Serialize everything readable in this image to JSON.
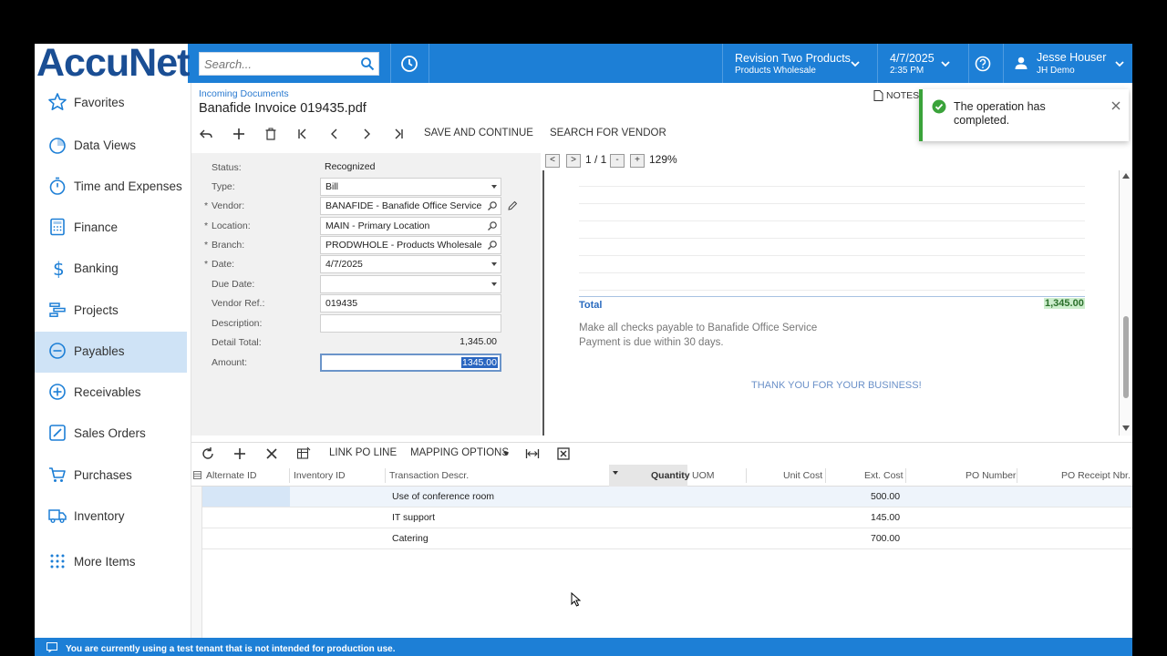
{
  "app": {
    "logo": "AccuNet"
  },
  "colors": {
    "brand": "#1d7fd6",
    "active_nav": "#cfe3f6",
    "success": "#3aa33a"
  },
  "search": {
    "placeholder": "Search..."
  },
  "header": {
    "company": "Revision Two Products",
    "branch": "Products Wholesale",
    "date": "4/7/2025",
    "time": "2:35 PM",
    "user": "Jesse Houser",
    "tenant": "JH Demo"
  },
  "sidebar": {
    "items": [
      {
        "label": "Favorites",
        "icon": "star-icon"
      },
      {
        "label": "Data Views",
        "icon": "pie-chart-icon"
      },
      {
        "label": "Time and Expenses",
        "icon": "stopwatch-icon"
      },
      {
        "label": "Finance",
        "icon": "calculator-icon"
      },
      {
        "label": "Banking",
        "icon": "dollar-icon"
      },
      {
        "label": "Projects",
        "icon": "gantt-icon"
      },
      {
        "label": "Payables",
        "icon": "minus-circle-icon",
        "active": true
      },
      {
        "label": "Receivables",
        "icon": "plus-circle-icon"
      },
      {
        "label": "Sales Orders",
        "icon": "edit-icon"
      },
      {
        "label": "Purchases",
        "icon": "cart-icon"
      },
      {
        "label": "Inventory",
        "icon": "truck-icon"
      },
      {
        "label": "More Items",
        "icon": "grid-dots-icon"
      }
    ]
  },
  "page": {
    "breadcrumb": "Incoming Documents",
    "title": "Banafide Invoice 019435.pdf",
    "notes": "NOTES"
  },
  "toolbar": {
    "save_continue": "SAVE AND CONTINUE",
    "search_vendor": "SEARCH FOR VENDOR"
  },
  "form": {
    "status": {
      "label": "Status:",
      "value": "Recognized"
    },
    "type": {
      "label": "Type:",
      "value": "Bill"
    },
    "vendor": {
      "label": "Vendor:",
      "value": "BANAFIDE - Banafide Office Service"
    },
    "location": {
      "label": "Location:",
      "value": "MAIN - Primary Location"
    },
    "branch": {
      "label": "Branch:",
      "value": "PRODWHOLE - Products Wholesale"
    },
    "date": {
      "label": "Date:",
      "value": "4/7/2025"
    },
    "due_date": {
      "label": "Due Date:",
      "value": ""
    },
    "vendor_ref": {
      "label": "Vendor Ref.:",
      "value": "019435"
    },
    "description": {
      "label": "Description:",
      "value": ""
    },
    "detail_total": {
      "label": "Detail Total:",
      "value": "1,345.00"
    },
    "amount": {
      "label": "Amount:",
      "value": "1345.00"
    }
  },
  "preview": {
    "page": "1 / 1",
    "zoom": "129%",
    "total_label": "Total",
    "total_value": "1,345.00",
    "note1": "Make all checks payable to Banafide Office Service",
    "note2": "Payment is due within 30 days.",
    "thanks": "THANK YOU FOR YOUR BUSINESS!"
  },
  "grid_toolbar": {
    "link_po": "LINK PO LINE",
    "mapping": "MAPPING OPTIONS"
  },
  "grid": {
    "columns": [
      "Alternate ID",
      "Inventory ID",
      "Transaction Descr.",
      "Quantity",
      "UOM",
      "Unit Cost",
      "Ext. Cost",
      "PO Number",
      "PO Receipt Nbr."
    ],
    "rows": [
      {
        "descr": "Use of conference room",
        "ext_cost": "500.00"
      },
      {
        "descr": "IT support",
        "ext_cost": "145.00"
      },
      {
        "descr": "Catering",
        "ext_cost": "700.00"
      }
    ]
  },
  "toast": {
    "message": "The operation has completed."
  },
  "footer": {
    "message": "You are currently using a test tenant that is not intended for production use."
  }
}
